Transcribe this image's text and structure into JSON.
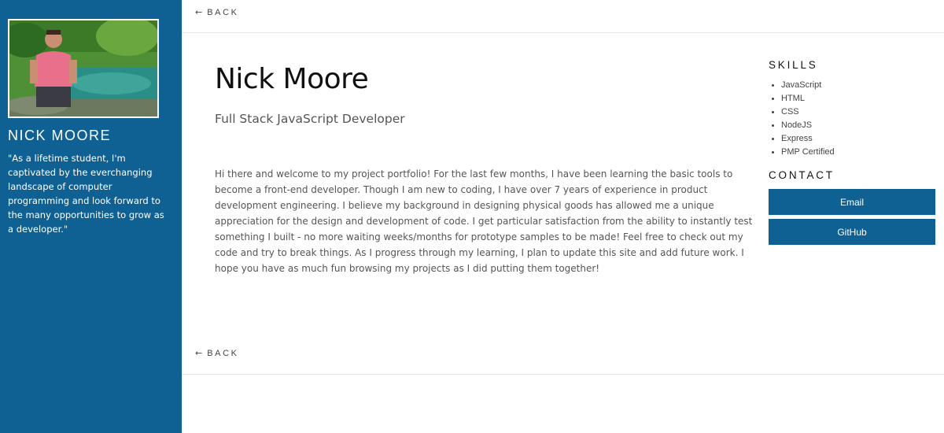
{
  "sidebar": {
    "name": "NICK MOORE",
    "quote": "\"As a lifetime student, I'm captivated by the everchanging landscape of computer programming and look forward to the many opportunities to grow as a developer.\""
  },
  "nav": {
    "back_arrow": "←",
    "back_label": "BACK"
  },
  "main": {
    "title": "Nick Moore",
    "subtitle": "Full Stack JavaScript Developer",
    "bio": "Hi there and welcome to my project portfolio! For the last few months, I have been learning the basic tools to become a front-end developer. Though I am new to coding, I have over 7 years of experience in product development engineering. I believe my background in designing physical goods has allowed me a unique appreciation for the design and development of code. I get particular satisfaction from the ability to instantly test something I built - no more waiting weeks/months for prototype samples to be made! Feel free to check out my code and try to break things. As I progress through my learning, I plan to update this site and add future work. I hope you have as much fun browsing my projects as I did putting them together!"
  },
  "skills": {
    "heading": "SKILLS",
    "items": [
      "JavaScript",
      "HTML",
      "CSS",
      "NodeJS",
      "Express",
      "PMP Certified"
    ]
  },
  "contact": {
    "heading": "CONTACT",
    "email_label": "Email",
    "github_label": "GitHub"
  },
  "colors": {
    "brand": "#0f6193",
    "text_dark": "#111111",
    "text_muted": "#555555"
  }
}
